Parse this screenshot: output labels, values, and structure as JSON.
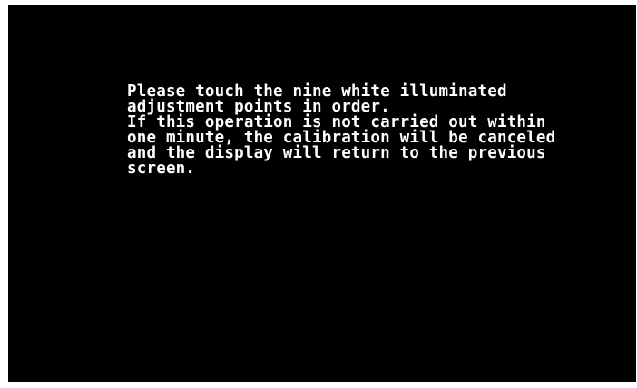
{
  "screen": {
    "background_color": "#000000",
    "text_color": "#ffffff",
    "message_lines": [
      "Please touch the nine white illuminated",
      "adjustment points in order.",
      "If this operation is not carried out within",
      "one minute, the calibration will be canceled",
      "and the display will return to the previous",
      "screen."
    ]
  }
}
